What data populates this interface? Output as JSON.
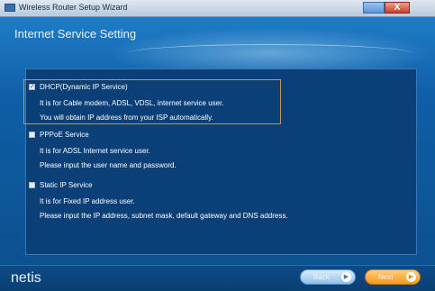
{
  "window": {
    "title": "Wireless Router Setup Wizard",
    "close_label": "X"
  },
  "page": {
    "title": "Internet Service Setting"
  },
  "options": [
    {
      "label": "DHCP(Dynamic IP Service)",
      "desc1": "It is for Cable modem, ADSL, VDSL, internet service user.",
      "desc2": "You will obtain IP address from your ISP automatically.",
      "checked": true
    },
    {
      "label": "PPPoE Service",
      "desc1": "It is for ADSL Internet service user.",
      "desc2": "Please input the user name and password.",
      "checked": false
    },
    {
      "label": "Static IP Service",
      "desc1": "It is for Fixed IP address user.",
      "desc2": "Please input the IP address, subnet mask, default gateway and DNS address.",
      "checked": false
    }
  ],
  "footer": {
    "brand": "netis",
    "back_label": "Back",
    "next_label": "Next"
  },
  "colors": {
    "accent_next": "#f39a1a",
    "accent_back": "#8fc1ea",
    "background": "#0e4f8a"
  }
}
